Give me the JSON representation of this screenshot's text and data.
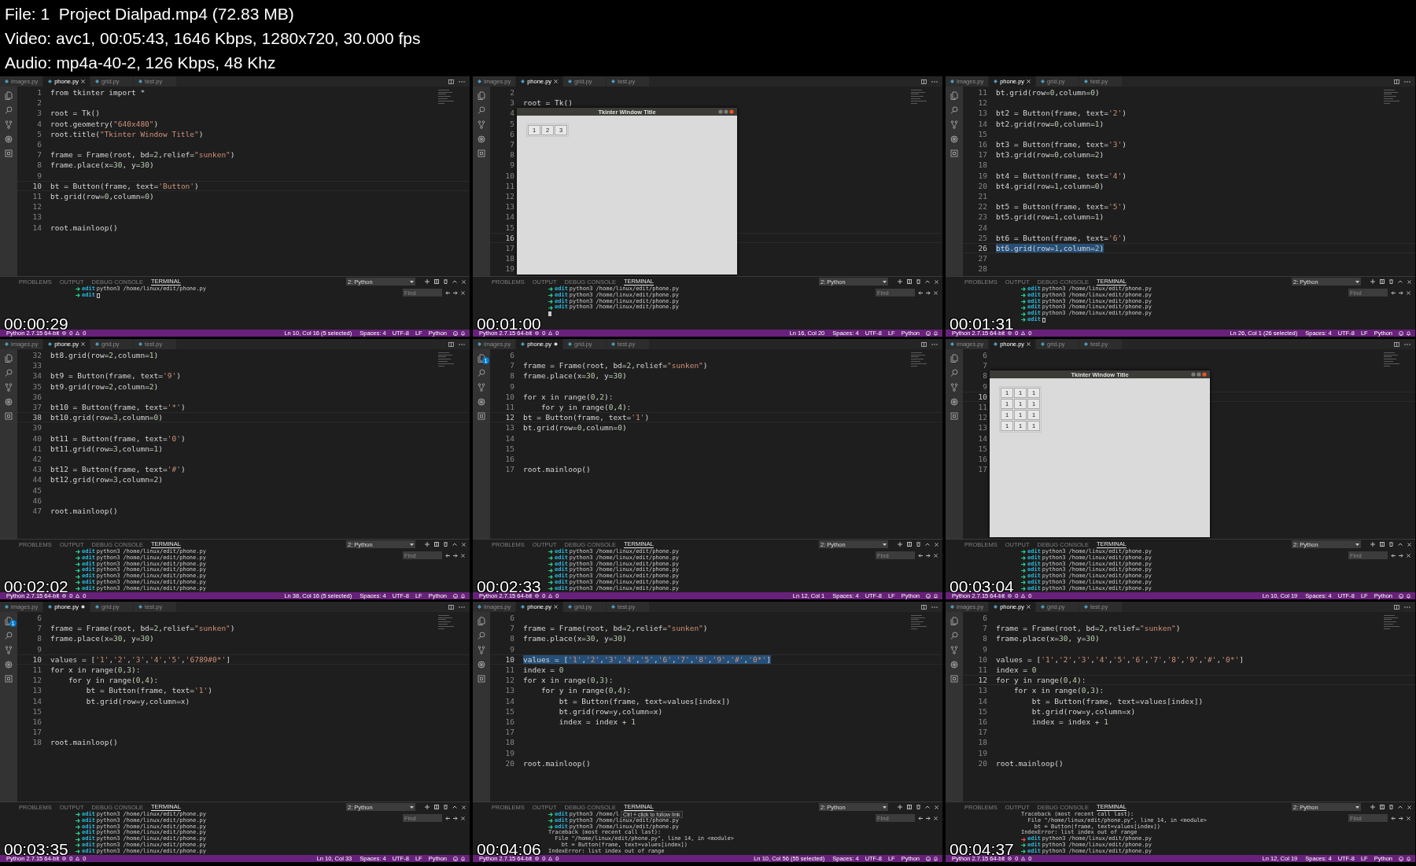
{
  "header": {
    "lines": [
      "File: 1  Project Dialpad.mp4 (72.83 MB)",
      "Video: avc1, 00:05:43, 1646 Kbps, 1280x720, 30.000 fps",
      "Audio: mp4a-40-2, 126 Kbps, 48 Khz"
    ]
  },
  "frames": [
    {
      "timestamp": "00:00:29",
      "tabs": [
        {
          "label": "images.py",
          "selected": false,
          "modified": false
        },
        {
          "label": "phone.py",
          "selected": true,
          "modified": false
        },
        {
          "label": "grid.py",
          "selected": false,
          "modified": false
        },
        {
          "label": "test.py",
          "selected": false,
          "modified": false
        }
      ],
      "lines": [
        {
          "n": "1",
          "code": "from tkinter import *",
          "current": false,
          "selected": false
        },
        {
          "n": "2",
          "current": false,
          "selected": false
        },
        {
          "n": "3",
          "code": "root = Tk()",
          "current": false,
          "selected": false
        },
        {
          "n": "4",
          "code": "root.geometry(\"640x480\")",
          "current": false,
          "selected": false
        },
        {
          "n": "5",
          "code": "root.title(\"Tkinter Window Title\")",
          "current": false,
          "selected": false
        },
        {
          "n": "6",
          "current": false,
          "selected": false
        },
        {
          "n": "7",
          "code": "frame = Frame(root, bd=2,relief=\"sunken\")",
          "current": false,
          "selected": false
        },
        {
          "n": "8",
          "code": "frame.place(x=30, y=30)",
          "current": false,
          "selected": false
        },
        {
          "n": "9",
          "current": false,
          "selected": false
        },
        {
          "n": "10",
          "code": "bt = Button(frame, text='Button')",
          "current": true,
          "selected": false
        },
        {
          "n": "11",
          "code": "bt.grid(row=0,column=0)",
          "current": false,
          "selected": false
        },
        {
          "n": "12",
          "current": false,
          "selected": false
        },
        {
          "n": "13",
          "current": false,
          "selected": false
        },
        {
          "n": "14",
          "code": "root.mainloop()",
          "current": false,
          "selected": false
        }
      ],
      "panel_tabs": [
        {
          "label": "PROBLEMS",
          "selected": false
        },
        {
          "label": "OUTPUT",
          "selected": false
        },
        {
          "label": "DEBUG CONSOLE",
          "selected": false
        },
        {
          "label": "TERMINAL",
          "selected": true
        }
      ],
      "terminal_picker": "2: Python",
      "find": {
        "placeholder": "Find"
      },
      "terminal": [
        {
          "kind": "prompt",
          "failed": false,
          "dir": "edit",
          "cmd": "python3 /home/linux/edit/phone.py"
        },
        {
          "kind": "prompt",
          "failed": false,
          "dir": "edit",
          "cursor": true
        }
      ],
      "status": {
        "interpreter": "Python 2.7.15 64-bit",
        "errors": "0",
        "warnings": "0",
        "position": "Ln 10, Col 16 (5 selected)",
        "indent": "Spaces: 4",
        "encoding": "UTF-8",
        "eol": "LF",
        "language": "Python"
      }
    },
    {
      "timestamp": "00:01:00",
      "tabs": [
        {
          "label": "images.py",
          "selected": false,
          "modified": false
        },
        {
          "label": "phone.py",
          "selected": true,
          "modified": false
        },
        {
          "label": "grid.py",
          "selected": false,
          "modified": false
        },
        {
          "label": "test.py",
          "selected": false,
          "modified": false
        }
      ],
      "lines": [
        {
          "n": "2",
          "current": false,
          "selected": false
        },
        {
          "n": "3",
          "code": "root = Tk()",
          "current": false,
          "selected": false
        },
        {
          "n": "4",
          "current": false,
          "selected": false
        },
        {
          "n": "5",
          "current": false,
          "selected": false
        },
        {
          "n": "6",
          "current": false,
          "selected": false
        },
        {
          "n": "7",
          "current": false,
          "selected": false
        },
        {
          "n": "8",
          "current": false,
          "selected": false
        },
        {
          "n": "9",
          "current": false,
          "selected": false
        },
        {
          "n": "10",
          "current": false,
          "selected": false
        },
        {
          "n": "11",
          "current": false,
          "selected": false
        },
        {
          "n": "12",
          "current": false,
          "selected": false
        },
        {
          "n": "13",
          "current": false,
          "selected": false
        },
        {
          "n": "14",
          "current": false,
          "selected": false
        },
        {
          "n": "15",
          "current": false,
          "selected": false
        },
        {
          "n": "16",
          "current": true,
          "selected": false
        },
        {
          "n": "17",
          "current": false,
          "selected": false
        },
        {
          "n": "18",
          "current": false,
          "selected": false
        },
        {
          "n": "19",
          "current": false,
          "selected": false
        }
      ],
      "tk_window": {
        "title": "Tkinter Window Title",
        "rows": [
          [
            "1",
            "2",
            "3"
          ]
        ]
      },
      "panel_tabs": [
        {
          "label": "PROBLEMS",
          "selected": false
        },
        {
          "label": "OUTPUT",
          "selected": false
        },
        {
          "label": "DEBUG CONSOLE",
          "selected": false
        },
        {
          "label": "TERMINAL",
          "selected": true
        }
      ],
      "terminal_picker": "2: Python",
      "find": {
        "placeholder": "Find"
      },
      "terminal": [
        {
          "kind": "prompt",
          "failed": false,
          "dir": "edit",
          "cmd": "python3 /home/linux/edit/phone.py"
        },
        {
          "kind": "prompt",
          "failed": false,
          "dir": "edit",
          "cmd": "python3 /home/linux/edit/phone.py"
        },
        {
          "kind": "prompt",
          "failed": false,
          "dir": "edit",
          "cmd": "python3 /home/linux/edit/phone.py"
        },
        {
          "kind": "prompt",
          "failed": false,
          "dir": "edit",
          "cmd": "python3 /home/linux/edit/phone.py"
        },
        {
          "kind": "cursor"
        }
      ],
      "status": {
        "interpreter": "Python 2.7.15 64-bit",
        "errors": "0",
        "warnings": "0",
        "position": "Ln 16, Col 20",
        "indent": "Spaces: 4",
        "encoding": "UTF-8",
        "eol": "LF",
        "language": "Python"
      }
    },
    {
      "timestamp": "00:01:31",
      "tabs": [
        {
          "label": "images.py",
          "selected": false,
          "modified": false
        },
        {
          "label": "phone.py",
          "selected": true,
          "modified": false
        },
        {
          "label": "grid.py",
          "selected": false,
          "modified": false
        },
        {
          "label": "test.py",
          "selected": false,
          "modified": false
        }
      ],
      "lines": [
        {
          "n": "11",
          "code": "bt.grid(row=0,column=0)",
          "current": false,
          "selected": false
        },
        {
          "n": "12",
          "current": false,
          "selected": false
        },
        {
          "n": "13",
          "code": "bt2 = Button(frame, text='2')",
          "current": false,
          "selected": false
        },
        {
          "n": "14",
          "code": "bt2.grid(row=0,column=1)",
          "current": false,
          "selected": false
        },
        {
          "n": "15",
          "current": false,
          "selected": false
        },
        {
          "n": "16",
          "code": "bt3 = Button(frame, text='3')",
          "current": false,
          "selected": false
        },
        {
          "n": "17",
          "code": "bt3.grid(row=0,column=2)",
          "current": false,
          "selected": false
        },
        {
          "n": "18",
          "current": false,
          "selected": false
        },
        {
          "n": "19",
          "code": "bt4 = Button(frame, text='4')",
          "current": false,
          "selected": false
        },
        {
          "n": "20",
          "code": "bt4.grid(row=1,column=0)",
          "current": false,
          "selected": false
        },
        {
          "n": "21",
          "current": false,
          "selected": false
        },
        {
          "n": "22",
          "code": "bt5 = Button(frame, text='5')",
          "current": false,
          "selected": false
        },
        {
          "n": "23",
          "code": "bt5.grid(row=1,column=1)",
          "current": false,
          "selected": false
        },
        {
          "n": "24",
          "current": false,
          "selected": false
        },
        {
          "n": "25",
          "code": "bt6 = Button(frame, text='6')",
          "current": false,
          "selected": false
        },
        {
          "n": "26",
          "code": "bt6.grid(row=1,column=2)",
          "current": true,
          "selected": true
        },
        {
          "n": "27",
          "current": false,
          "selected": false
        },
        {
          "n": "28",
          "current": false,
          "selected": false
        }
      ],
      "panel_tabs": [
        {
          "label": "PROBLEMS",
          "selected": false
        },
        {
          "label": "OUTPUT",
          "selected": false
        },
        {
          "label": "DEBUG CONSOLE",
          "selected": false
        },
        {
          "label": "TERMINAL",
          "selected": true
        }
      ],
      "terminal_picker": "2: Python",
      "find": {
        "placeholder": "Find"
      },
      "terminal": [
        {
          "kind": "prompt",
          "failed": false,
          "dir": "edit",
          "cmd": "python3 /home/linux/edit/phone.py"
        },
        {
          "kind": "prompt",
          "failed": false,
          "dir": "edit",
          "cmd": "python3 /home/linux/edit/phone.py"
        },
        {
          "kind": "prompt",
          "failed": false,
          "dir": "edit",
          "cmd": "python3 /home/linux/edit/phone.py"
        },
        {
          "kind": "prompt",
          "failed": false,
          "dir": "edit",
          "cmd": "python3 /home/linux/edit/phone.py"
        },
        {
          "kind": "prompt",
          "failed": false,
          "dir": "edit",
          "cmd": "python3 /home/linux/edit/phone.py"
        },
        {
          "kind": "prompt",
          "failed": false,
          "dir": "edit",
          "cursor": true
        }
      ],
      "status": {
        "interpreter": "Python 2.7.15 64-bit",
        "errors": "0",
        "warnings": "0",
        "position": "Ln 26, Col 1 (26 selected)",
        "indent": "Spaces: 4",
        "encoding": "UTF-8",
        "eol": "LF",
        "language": "Python"
      }
    },
    {
      "timestamp": "00:02:02",
      "tabs": [
        {
          "label": "images.py",
          "selected": false,
          "modified": false
        },
        {
          "label": "phone.py",
          "selected": true,
          "modified": false
        },
        {
          "label": "grid.py",
          "selected": false,
          "modified": false
        },
        {
          "label": "test.py",
          "selected": false,
          "modified": false
        }
      ],
      "lines": [
        {
          "n": "32",
          "code": "bt8.grid(row=2,column=1)",
          "current": false,
          "selected": false
        },
        {
          "n": "33",
          "current": false,
          "selected": false
        },
        {
          "n": "34",
          "code": "bt9 = Button(frame, text='9')",
          "current": false,
          "selected": false
        },
        {
          "n": "35",
          "code": "bt9.grid(row=2,column=2)",
          "current": false,
          "selected": false
        },
        {
          "n": "36",
          "current": false,
          "selected": false
        },
        {
          "n": "37",
          "code": "bt10 = Button(frame, text='*')",
          "current": false,
          "selected": false
        },
        {
          "n": "38",
          "code": "bt10.grid(row=3,column=0)",
          "current": true,
          "selected": false
        },
        {
          "n": "39",
          "current": false,
          "selected": false
        },
        {
          "n": "40",
          "code": "bt11 = Button(frame, text='0')",
          "current": false,
          "selected": false
        },
        {
          "n": "41",
          "code": "bt11.grid(row=3,column=1)",
          "current": false,
          "selected": false
        },
        {
          "n": "42",
          "current": false,
          "selected": false
        },
        {
          "n": "43",
          "code": "bt12 = Button(frame, text='#')",
          "current": false,
          "selected": false
        },
        {
          "n": "44",
          "code": "bt12.grid(row=3,column=2)",
          "current": false,
          "selected": false
        },
        {
          "n": "45",
          "current": false,
          "selected": false
        },
        {
          "n": "46",
          "current": false,
          "selected": false
        },
        {
          "n": "47",
          "code": "root.mainloop()",
          "current": false,
          "selected": false
        }
      ],
      "panel_tabs": [
        {
          "label": "PROBLEMS",
          "selected": false
        },
        {
          "label": "OUTPUT",
          "selected": false
        },
        {
          "label": "DEBUG CONSOLE",
          "selected": false
        },
        {
          "label": "TERMINAL",
          "selected": true
        }
      ],
      "terminal_picker": "2: Python",
      "find": {
        "placeholder": "Find"
      },
      "terminal": [
        {
          "kind": "prompt",
          "failed": false,
          "dir": "edit",
          "cmd": "python3 /home/linux/edit/phone.py"
        },
        {
          "kind": "prompt",
          "failed": false,
          "dir": "edit",
          "cmd": "python3 /home/linux/edit/phone.py"
        },
        {
          "kind": "prompt",
          "failed": false,
          "dir": "edit",
          "cmd": "python3 /home/linux/edit/phone.py"
        },
        {
          "kind": "prompt",
          "failed": false,
          "dir": "edit",
          "cmd": "python3 /home/linux/edit/phone.py"
        },
        {
          "kind": "prompt",
          "failed": false,
          "dir": "edit",
          "cmd": "python3 /home/linux/edit/phone.py"
        },
        {
          "kind": "prompt",
          "failed": false,
          "dir": "edit",
          "cmd": "python3 /home/linux/edit/phone.py"
        },
        {
          "kind": "prompt",
          "failed": false,
          "dir": "edit",
          "cmd": "python3 /home/linux/edit/phone.py"
        }
      ],
      "status": {
        "interpreter": "Python 2.7.15 64-bit",
        "errors": "0",
        "warnings": "0",
        "position": "Ln 38, Col 16 (5 selected)",
        "indent": "Spaces: 4",
        "encoding": "UTF-8",
        "eol": "LF",
        "language": "Python"
      }
    },
    {
      "timestamp": "00:02:33",
      "activity_badge": "1",
      "tabs": [
        {
          "label": "images.py",
          "selected": false,
          "modified": false
        },
        {
          "label": "phone.py",
          "selected": true,
          "modified": true
        },
        {
          "label": "grid.py",
          "selected": false,
          "modified": false
        },
        {
          "label": "test.py",
          "selected": false,
          "modified": false
        }
      ],
      "lines": [
        {
          "n": "6",
          "current": false,
          "selected": false
        },
        {
          "n": "7",
          "code": "frame = Frame(root, bd=2,relief=\"sunken\")",
          "current": false,
          "selected": false
        },
        {
          "n": "8",
          "code": "frame.place(x=30, y=30)",
          "current": false,
          "selected": false
        },
        {
          "n": "9",
          "current": false,
          "selected": false
        },
        {
          "n": "10",
          "code": "for x in range(0,2):",
          "current": false,
          "selected": false
        },
        {
          "n": "11",
          "code": "    for y in range(0,4):",
          "current": false,
          "selected": false
        },
        {
          "n": "12",
          "code": "bt = Button(frame, text='1')",
          "current": true,
          "selected": false
        },
        {
          "n": "13",
          "code": "bt.grid(row=0,column=0)",
          "current": false,
          "selected": false
        },
        {
          "n": "14",
          "current": false,
          "selected": false
        },
        {
          "n": "15",
          "current": false,
          "selected": false
        },
        {
          "n": "16",
          "current": false,
          "selected": false
        },
        {
          "n": "17",
          "code": "root.mainloop()",
          "current": false,
          "selected": false
        }
      ],
      "panel_tabs": [
        {
          "label": "PROBLEMS",
          "selected": false
        },
        {
          "label": "OUTPUT",
          "selected": false
        },
        {
          "label": "DEBUG CONSOLE",
          "selected": false
        },
        {
          "label": "TERMINAL",
          "selected": true
        }
      ],
      "terminal_picker": "2: Python",
      "find": {
        "placeholder": "Find"
      },
      "terminal": [
        {
          "kind": "prompt",
          "failed": false,
          "dir": "edit",
          "cmd": "python3 /home/linux/edit/phone.py"
        },
        {
          "kind": "prompt",
          "failed": false,
          "dir": "edit",
          "cmd": "python3 /home/linux/edit/phone.py"
        },
        {
          "kind": "prompt",
          "failed": false,
          "dir": "edit",
          "cmd": "python3 /home/linux/edit/phone.py"
        },
        {
          "kind": "prompt",
          "failed": false,
          "dir": "edit",
          "cmd": "python3 /home/linux/edit/phone.py"
        },
        {
          "kind": "prompt",
          "failed": false,
          "dir": "edit",
          "cmd": "python3 /home/linux/edit/phone.py"
        },
        {
          "kind": "prompt",
          "failed": false,
          "dir": "edit",
          "cmd": "python3 /home/linux/edit/phone.py"
        },
        {
          "kind": "prompt",
          "failed": false,
          "dir": "edit",
          "cmd": "python3 /home/linux/edit/phone.py"
        }
      ],
      "status": {
        "interpreter": "Python 2.7.15 64-bit",
        "errors": "0",
        "warnings": "0",
        "position": "Ln 12, Col 1",
        "indent": "Spaces: 4",
        "encoding": "UTF-8",
        "eol": "LF",
        "language": "Python"
      }
    },
    {
      "timestamp": "00:03:04",
      "tabs": [
        {
          "label": "images.py",
          "selected": false,
          "modified": false
        },
        {
          "label": "phone.py",
          "selected": true,
          "modified": false
        },
        {
          "label": "grid.py",
          "selected": false,
          "modified": false
        },
        {
          "label": "test.py",
          "selected": false,
          "modified": false
        }
      ],
      "lines": [
        {
          "n": "6",
          "current": false,
          "selected": false
        },
        {
          "n": "7",
          "current": false,
          "selected": false
        },
        {
          "n": "8",
          "current": false,
          "selected": false
        },
        {
          "n": "9",
          "current": false,
          "selected": false
        },
        {
          "n": "10",
          "current": true,
          "selected": false
        },
        {
          "n": "11",
          "current": false,
          "selected": false
        },
        {
          "n": "12",
          "current": false,
          "selected": false
        },
        {
          "n": "13",
          "current": false,
          "selected": false
        },
        {
          "n": "14",
          "current": false,
          "selected": false
        },
        {
          "n": "15",
          "current": false,
          "selected": false
        },
        {
          "n": "16",
          "current": false,
          "selected": false
        },
        {
          "n": "17",
          "current": false,
          "selected": false
        }
      ],
      "tk_window": {
        "title": "Tkinter Window Title",
        "rows": [
          [
            "1",
            "1",
            "1"
          ],
          [
            "1",
            "1",
            "1"
          ],
          [
            "1",
            "1",
            "1"
          ],
          [
            "1",
            "1",
            "1"
          ]
        ]
      },
      "panel_tabs": [
        {
          "label": "PROBLEMS",
          "selected": false
        },
        {
          "label": "OUTPUT",
          "selected": false
        },
        {
          "label": "DEBUG CONSOLE",
          "selected": false
        },
        {
          "label": "TERMINAL",
          "selected": true
        }
      ],
      "terminal_picker": "2: Python",
      "find": {
        "placeholder": "Find"
      },
      "terminal": [
        {
          "kind": "prompt",
          "failed": false,
          "dir": "edit",
          "cmd": "python3 /home/linux/edit/phone.py"
        },
        {
          "kind": "prompt",
          "failed": false,
          "dir": "edit",
          "cmd": "python3 /home/linux/edit/phone.py"
        },
        {
          "kind": "prompt",
          "failed": false,
          "dir": "edit",
          "cmd": "python3 /home/linux/edit/phone.py"
        },
        {
          "kind": "prompt",
          "failed": false,
          "dir": "edit",
          "cmd": "python3 /home/linux/edit/phone.py"
        },
        {
          "kind": "prompt",
          "failed": false,
          "dir": "edit",
          "cmd": "python3 /home/linux/edit/phone.py"
        },
        {
          "kind": "prompt",
          "failed": false,
          "dir": "edit",
          "cmd": "python3 /home/linux/edit/phone.py"
        },
        {
          "kind": "prompt",
          "failed": false,
          "dir": "edit",
          "cmd": "python3 /home/linux/edit/phone.py"
        }
      ],
      "status": {
        "interpreter": "Python 2.7.15 64-bit",
        "errors": "0",
        "warnings": "0",
        "position": "Ln 10, Col 19",
        "indent": "Spaces: 4",
        "encoding": "UTF-8",
        "eol": "LF",
        "language": "Python"
      }
    },
    {
      "timestamp": "00:03:35",
      "activity_badge": "1",
      "tabs": [
        {
          "label": "images.py",
          "selected": false,
          "modified": false
        },
        {
          "label": "phone.py",
          "selected": true,
          "modified": true
        },
        {
          "label": "grid.py",
          "selected": false,
          "modified": false
        },
        {
          "label": "test.py",
          "selected": false,
          "modified": false
        }
      ],
      "lines": [
        {
          "n": "6",
          "current": false,
          "selected": false
        },
        {
          "n": "7",
          "code": "frame = Frame(root, bd=2,relief=\"sunken\")",
          "current": false,
          "selected": false
        },
        {
          "n": "8",
          "code": "frame.place(x=30, y=30)",
          "current": false,
          "selected": false
        },
        {
          "n": "9",
          "current": false,
          "selected": false
        },
        {
          "n": "10",
          "code": "values = ['1','2','3','4','5','6789#0*']",
          "current": true,
          "selected": false
        },
        {
          "n": "11",
          "code": "for x in range(0,3):",
          "current": false,
          "selected": false
        },
        {
          "n": "12",
          "code": "    for y in range(0,4):",
          "current": false,
          "selected": false
        },
        {
          "n": "13",
          "code": "        bt = Button(frame, text='1')",
          "current": false,
          "selected": false
        },
        {
          "n": "14",
          "code": "        bt.grid(row=y,column=x)",
          "current": false,
          "selected": false
        },
        {
          "n": "15",
          "current": false,
          "selected": false
        },
        {
          "n": "16",
          "current": false,
          "selected": false
        },
        {
          "n": "17",
          "current": false,
          "selected": false
        },
        {
          "n": "18",
          "code": "root.mainloop()",
          "current": false,
          "selected": false
        }
      ],
      "panel_tabs": [
        {
          "label": "PROBLEMS",
          "selected": false
        },
        {
          "label": "OUTPUT",
          "selected": false
        },
        {
          "label": "DEBUG CONSOLE",
          "selected": false
        },
        {
          "label": "TERMINAL",
          "selected": true
        }
      ],
      "terminal_picker": "2: Python",
      "find": {
        "placeholder": "Find"
      },
      "terminal": [
        {
          "kind": "prompt",
          "failed": false,
          "dir": "edit",
          "cmd": "python3 /home/linux/edit/phone.py"
        },
        {
          "kind": "prompt",
          "failed": false,
          "dir": "edit",
          "cmd": "python3 /home/linux/edit/phone.py"
        },
        {
          "kind": "prompt",
          "failed": false,
          "dir": "edit",
          "cmd": "python3 /home/linux/edit/phone.py"
        },
        {
          "kind": "prompt",
          "failed": false,
          "dir": "edit",
          "cmd": "python3 /home/linux/edit/phone.py"
        },
        {
          "kind": "prompt",
          "failed": false,
          "dir": "edit",
          "cmd": "python3 /home/linux/edit/phone.py"
        },
        {
          "kind": "prompt",
          "failed": false,
          "dir": "edit",
          "cmd": "python3 /home/linux/edit/phone.py"
        },
        {
          "kind": "prompt",
          "failed": false,
          "dir": "edit",
          "cmd": "python3 /home/linux/edit/phone.py"
        }
      ],
      "status": {
        "interpreter": "Python 2.7.15 64-bit",
        "errors": "0",
        "warnings": "0",
        "position": "Ln 10, Col 33",
        "indent": "Spaces: 4",
        "encoding": "UTF-8",
        "eol": "LF",
        "language": "Python"
      }
    },
    {
      "timestamp": "00:04:06",
      "tabs": [
        {
          "label": "images.py",
          "selected": false,
          "modified": false
        },
        {
          "label": "phone.py",
          "selected": true,
          "modified": false
        },
        {
          "label": "grid.py",
          "selected": false,
          "modified": false
        },
        {
          "label": "test.py",
          "selected": false,
          "modified": false
        }
      ],
      "lines": [
        {
          "n": "6",
          "current": false,
          "selected": false
        },
        {
          "n": "7",
          "code": "frame = Frame(root, bd=2,relief=\"sunken\")",
          "current": false,
          "selected": false
        },
        {
          "n": "8",
          "code": "frame.place(x=30, y=30)",
          "current": false,
          "selected": false
        },
        {
          "n": "9",
          "current": false,
          "selected": false
        },
        {
          "n": "10",
          "code": "values = ['1','2','3','4','5','6','7','8','9','#','0*']",
          "current": true,
          "selected": true
        },
        {
          "n": "11",
          "code": "index = 0",
          "current": false,
          "selected": false
        },
        {
          "n": "12",
          "code": "for x in range(0,3):",
          "current": false,
          "selected": false
        },
        {
          "n": "13",
          "code": "    for y in range(0,4):",
          "current": false,
          "selected": false
        },
        {
          "n": "14",
          "code": "        bt = Button(frame, text=values[index])",
          "current": false,
          "selected": false
        },
        {
          "n": "15",
          "code": "        bt.grid(row=y,column=x)",
          "current": false,
          "selected": false
        },
        {
          "n": "16",
          "code": "        index = index + 1",
          "current": false,
          "selected": false
        },
        {
          "n": "17",
          "current": false,
          "selected": false
        },
        {
          "n": "18",
          "current": false,
          "selected": false
        },
        {
          "n": "19",
          "current": false,
          "selected": false
        },
        {
          "n": "20",
          "code": "root.mainloop()",
          "current": false,
          "selected": false
        }
      ],
      "panel_tabs": [
        {
          "label": "PROBLEMS",
          "selected": false
        },
        {
          "label": "OUTPUT",
          "selected": false
        },
        {
          "label": "DEBUG CONSOLE",
          "selected": false
        },
        {
          "label": "TERMINAL",
          "selected": true
        }
      ],
      "terminal_picker": "2: Python",
      "find": {
        "placeholder": "Find"
      },
      "terminal": [
        {
          "kind": "prompt",
          "failed": false,
          "dir": "edit",
          "cmd": "python3 /home/l",
          "tooltip": "Ctrl + click to follow link"
        },
        {
          "kind": "prompt",
          "failed": false,
          "dir": "edit",
          "cmd": "python3 /home/linux/edit/phone.py"
        },
        {
          "kind": "prompt",
          "failed": false,
          "dir": "edit",
          "cmd": "python3 /home/linux/edit/phone.py"
        },
        {
          "kind": "output",
          "text": "Traceback (most recent call last):"
        },
        {
          "kind": "output",
          "text": "  File \"/home/linux/edit/phone.py\", line 14, in <module>"
        },
        {
          "kind": "output",
          "text": "    bt = Button(frame, text=values[index])"
        },
        {
          "kind": "output",
          "text": "IndexError: list index out of range"
        }
      ],
      "status": {
        "interpreter": "Python 2.7.15 64-bit",
        "errors": "0",
        "warnings": "0",
        "position": "Ln 10, Col 56 (55 selected)",
        "indent": "Spaces: 4",
        "encoding": "UTF-8",
        "eol": "LF",
        "language": "Python"
      }
    },
    {
      "timestamp": "00:04:37",
      "tabs": [
        {
          "label": "images.py",
          "selected": false,
          "modified": false
        },
        {
          "label": "phone.py",
          "selected": true,
          "modified": false
        },
        {
          "label": "grid.py",
          "selected": false,
          "modified": false
        },
        {
          "label": "test.py",
          "selected": false,
          "modified": false
        }
      ],
      "lines": [
        {
          "n": "6",
          "current": false,
          "selected": false
        },
        {
          "n": "7",
          "code": "frame = Frame(root, bd=2,relief=\"sunken\")",
          "current": false,
          "selected": false
        },
        {
          "n": "8",
          "code": "frame.place(x=30, y=30)",
          "current": false,
          "selected": false
        },
        {
          "n": "9",
          "current": false,
          "selected": false
        },
        {
          "n": "10",
          "code": "values = ['1','2','3','4','5','6','7','8','9','#','0*']",
          "current": false,
          "selected": false
        },
        {
          "n": "11",
          "code": "index = 0",
          "current": false,
          "selected": false
        },
        {
          "n": "12",
          "code": "for y in range(0,4):",
          "current": true,
          "selected": false
        },
        {
          "n": "13",
          "code": "    for x in range(0,3):",
          "current": false,
          "selected": false
        },
        {
          "n": "14",
          "code": "        bt = Button(frame, text=values[index])",
          "current": false,
          "selected": false
        },
        {
          "n": "15",
          "code": "        bt.grid(row=y,column=x)",
          "current": false,
          "selected": false
        },
        {
          "n": "16",
          "code": "        index = index + 1",
          "current": false,
          "selected": false
        },
        {
          "n": "17",
          "current": false,
          "selected": false
        },
        {
          "n": "18",
          "current": false,
          "selected": false
        },
        {
          "n": "19",
          "current": false,
          "selected": false
        },
        {
          "n": "20",
          "code": "root.mainloop()",
          "current": false,
          "selected": false
        }
      ],
      "panel_tabs": [
        {
          "label": "PROBLEMS",
          "selected": false
        },
        {
          "label": "OUTPUT",
          "selected": false
        },
        {
          "label": "DEBUG CONSOLE",
          "selected": false
        },
        {
          "label": "TERMINAL",
          "selected": true
        }
      ],
      "terminal_picker": "2: Python",
      "find": {
        "placeholder": "Find"
      },
      "terminal": [
        {
          "kind": "output",
          "text": "Traceback (most recent call last):"
        },
        {
          "kind": "output",
          "text": "  File \"/home/linux/edit/phone.py\", line 14, in <module>"
        },
        {
          "kind": "output",
          "text": "    bt = Button(frame, text=values[index])"
        },
        {
          "kind": "output",
          "text": "IndexError: list index out of range"
        },
        {
          "kind": "prompt",
          "failed": true,
          "dir": "edit",
          "cmd": "python3 /home/linux/edit/phone.py"
        },
        {
          "kind": "prompt",
          "failed": false,
          "dir": "edit",
          "cmd": "python3 /home/linux/edit/phone.py"
        },
        {
          "kind": "prompt",
          "failed": false,
          "dir": "edit",
          "cmd": "python3 /home/linux/edit/phone.py"
        }
      ],
      "status": {
        "interpreter": "Python 2.7.15 64-bit",
        "errors": "0",
        "warnings": "0",
        "position": "Ln 12, Col 19",
        "indent": "Spaces: 4",
        "encoding": "UTF-8",
        "eol": "LF",
        "language": "Python"
      }
    }
  ]
}
